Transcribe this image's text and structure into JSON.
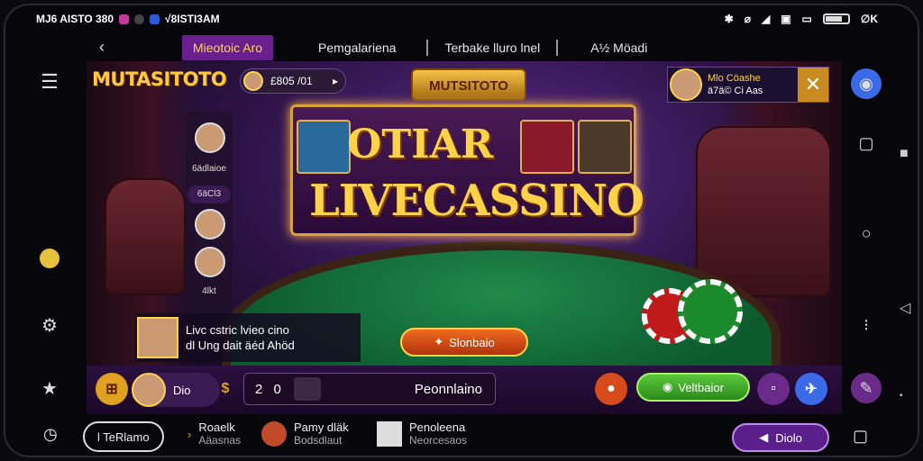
{
  "status": {
    "time_text": "MJ6 AISTO 380",
    "wifi_text": "√8ISTI3AM",
    "battery_text": "∅K"
  },
  "tabs": [
    {
      "label": "Mieotoic Aro",
      "active": true
    },
    {
      "label": "Pemgalariena",
      "active": false
    },
    {
      "label": "Terbake lluro lnel",
      "active": false
    },
    {
      "label": "A½ Möadi",
      "active": false
    }
  ],
  "game": {
    "logo": "MUTASITOTO",
    "top_pill": "£805 /01 ",
    "header_badge": "MUTSITOTO",
    "title_line1": "OTIAR",
    "title_line2": "LIVECASSINO",
    "players": [
      {
        "label": "6ädlaioe"
      },
      {
        "label": "6äCl3"
      },
      {
        "label": "4lkt"
      }
    ],
    "promo": {
      "line1": "Mlo Cöashe",
      "line2": "ä7ä© Ci Aas"
    },
    "chat": {
      "line1": "Livc cstric lvieo cino",
      "line2": "dl Ung dait äéd Ahöd"
    },
    "spin_label": "Slonbaio"
  },
  "controls": {
    "bet_label": "Dio",
    "amount": "2 0",
    "amount_label": "Peonnlaino",
    "green_label": "Veltbaior"
  },
  "bottom_nav": {
    "pill_label": "l TeRlamo",
    "item1": {
      "title": "Roaelk",
      "sub": "Aäasnas"
    },
    "item2": {
      "title": "Pamy dläk",
      "sub": "Bodsdlaut"
    },
    "item3": {
      "title": "Penoleena",
      "sub": "Neorcesaos"
    },
    "purple_label": "Diolo"
  },
  "colors": {
    "accent": "#6a1f8f",
    "gold": "#ffd24a",
    "felt": "#0d5a2d"
  }
}
